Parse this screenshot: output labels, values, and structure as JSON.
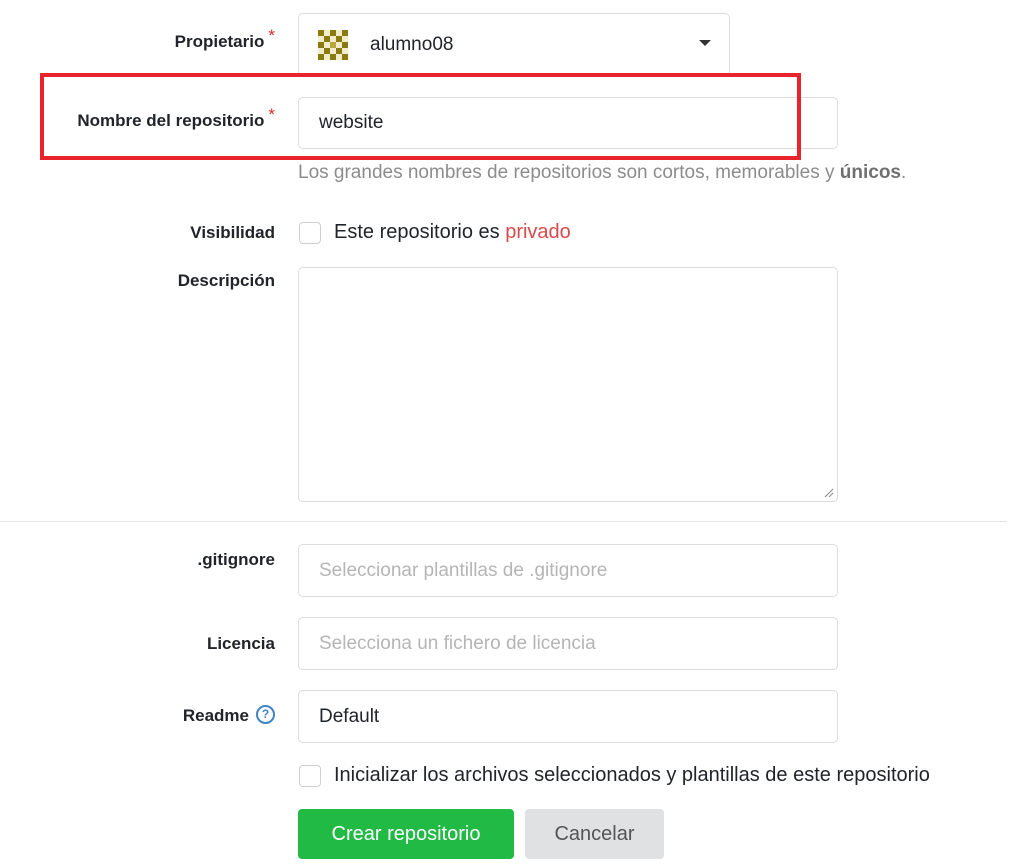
{
  "owner": {
    "label": "Propietario",
    "required_mark": "*",
    "value": "alumno08"
  },
  "repo_name": {
    "label": "Nombre del repositorio",
    "required_mark": "*",
    "value": "website",
    "hint_prefix": "Los grandes nombres de repositorios son cortos, memorables y ",
    "hint_emphasis": "únicos",
    "hint_suffix": "."
  },
  "visibility": {
    "label": "Visibilidad",
    "checkbox_text": "Este repositorio es ",
    "checkbox_accent": "privado",
    "checked": false
  },
  "description": {
    "label": "Descripción",
    "value": ""
  },
  "gitignore": {
    "label": ".gitignore",
    "placeholder": "Seleccionar plantillas de .gitignore"
  },
  "license": {
    "label": "Licencia",
    "placeholder": "Selecciona un fichero de licencia"
  },
  "readme": {
    "label": "Readme",
    "help_icon": "question-circle-icon",
    "value": "Default"
  },
  "auto_init": {
    "text": "Inicializar los archivos seleccionados y plantillas de este repositorio",
    "checked": false
  },
  "actions": {
    "create_label": "Crear repositorio",
    "cancel_label": "Cancelar"
  },
  "colors": {
    "primary": "#21ba45",
    "required": "#db2828",
    "highlight": "#e8232b",
    "accent": "#4183c4"
  }
}
